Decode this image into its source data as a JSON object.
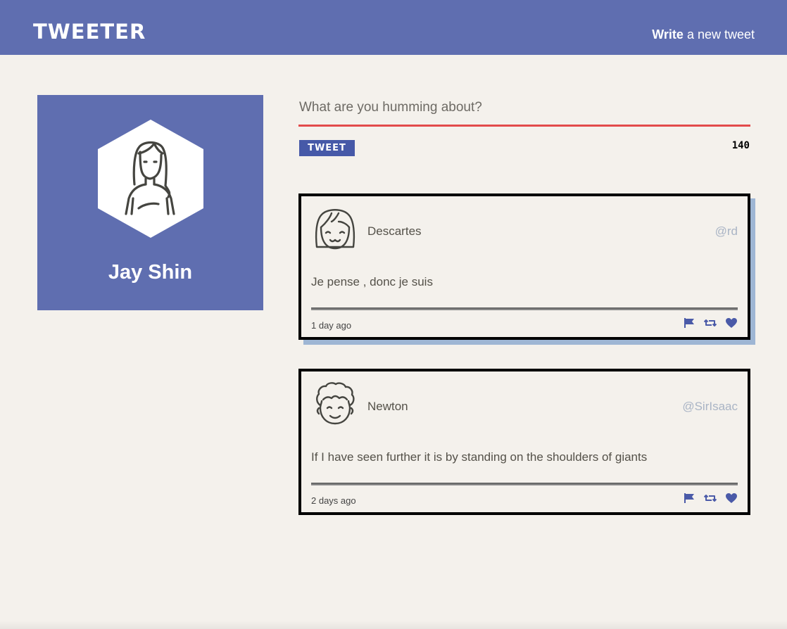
{
  "nav": {
    "brand": "TWEETER",
    "compose_bold": "Write",
    "compose_rest": " a new tweet"
  },
  "profile": {
    "name": "Jay Shin",
    "avatar_icon": "woman-avatar-icon"
  },
  "composer": {
    "placeholder": "What are you humming about?",
    "value": "",
    "button_label": "TWEET",
    "counter": "140"
  },
  "tweets": [
    {
      "author": "Descartes",
      "handle": "@rd",
      "content": "Je pense , donc je suis",
      "timestamp": "1 day ago",
      "avatar_icon": "girl-avatar-icon"
    },
    {
      "author": "Newton",
      "handle": "@SirIsaac",
      "content": "If I have seen further it is by standing on the shoulders of giants",
      "timestamp": "2 days ago",
      "avatar_icon": "curly-hair-avatar-icon"
    }
  ],
  "icons": {
    "flag": "flag-icon",
    "retweet": "retweet-icon",
    "like": "heart-icon"
  },
  "colors": {
    "nav_bg": "#5f6eb0",
    "page_bg": "#f4f1ec",
    "accent_red": "#e34b4b",
    "button_bg": "#4659a8",
    "icon_blue": "#4a5aa8",
    "handle": "#a9b4c5",
    "shadow": "#9eb6d4"
  }
}
